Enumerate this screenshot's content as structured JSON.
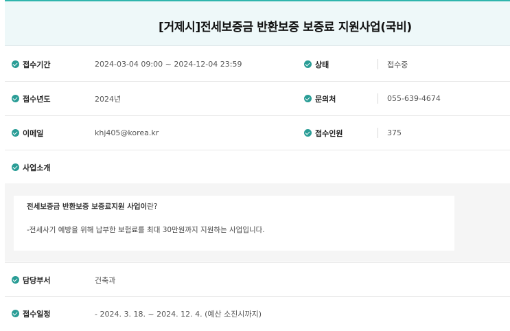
{
  "title": "[거제시]전세보증금 반환보증 보증료 지원사업(국비)",
  "rows": [
    {
      "left_label": "접수기간",
      "left_value": "2024-03-04 09:00 ~ 2024-12-04 23:59",
      "right_label": "상태",
      "right_value": "접수중"
    },
    {
      "left_label": "접수년도",
      "left_value": "2024년",
      "right_label": "문의처",
      "right_value": "055-639-4674"
    },
    {
      "left_label": "이메일",
      "left_value": "khj405@korea.kr",
      "right_label": "접수인원",
      "right_value": "375"
    }
  ],
  "intro": {
    "label": "사업소개",
    "line1_bold": "전세보증금 반환보증 보증료지원 사업이",
    "line1_rest": "란?",
    "line2": "-전세사기 예방을 위해 납부한 보험료를 최대 30만원까지 지원하는 사업입니다."
  },
  "department": {
    "label": "담당부서",
    "value": "건축과"
  },
  "schedule": {
    "label": "접수일정",
    "value": "- 2024. 3. 18. ~ 2024. 12. 4. (예산 소진시까지)"
  },
  "colors": {
    "accent": "#2a9d96",
    "title_bg": "#eef8f9",
    "top_border": "#2fb5ad"
  }
}
